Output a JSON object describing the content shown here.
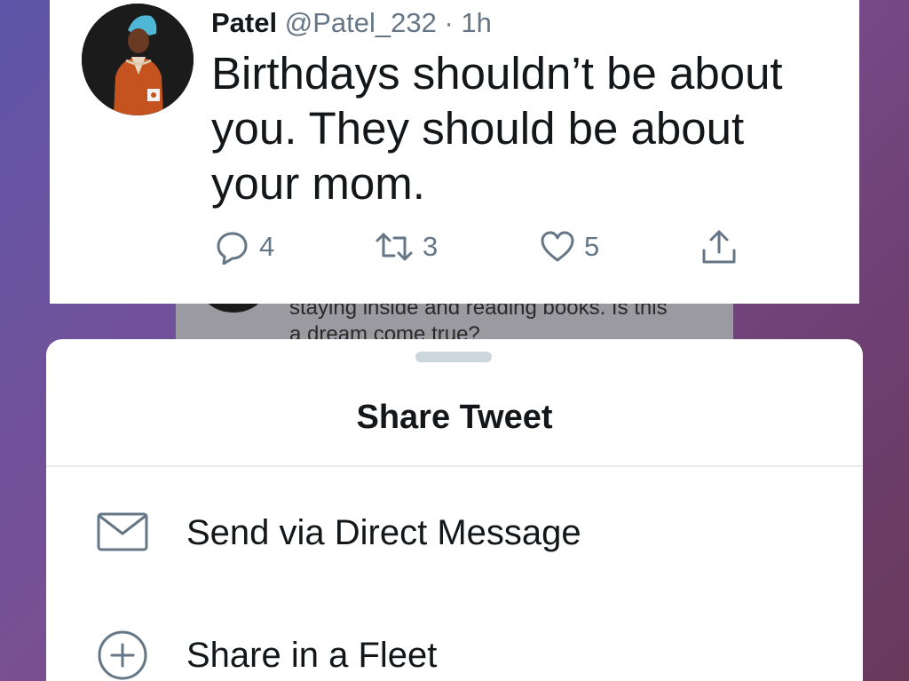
{
  "tweet": {
    "display_name": "Patel",
    "handle": "@Patel_232",
    "separator": "·",
    "time_ago": "1h",
    "text": "Birthdays shouldn’t be about you. They should be about your mom.",
    "reply_count": "4",
    "retweet_count": "3",
    "like_count": "5",
    "icons": [
      "reply-icon",
      "retweet-icon",
      "like-icon",
      "share-icon"
    ]
  },
  "behind_tweet": {
    "line_1": "staying inside and reading books. Is this",
    "line_2": "a dream come true?"
  },
  "share_sheet": {
    "title": "Share Tweet",
    "items": [
      {
        "label": "Send via Direct Message",
        "icon": "envelope-icon"
      },
      {
        "label": "Share in a Fleet",
        "icon": "plus-circle-icon"
      }
    ]
  },
  "colors": {
    "text_primary": "#14171a",
    "text_secondary": "#657786",
    "divider": "#e6ecf0",
    "grabber": "#ccd6dd",
    "background_gradient": [
      "#5e55a8",
      "#7a4f92",
      "#6a3a5c"
    ]
  }
}
